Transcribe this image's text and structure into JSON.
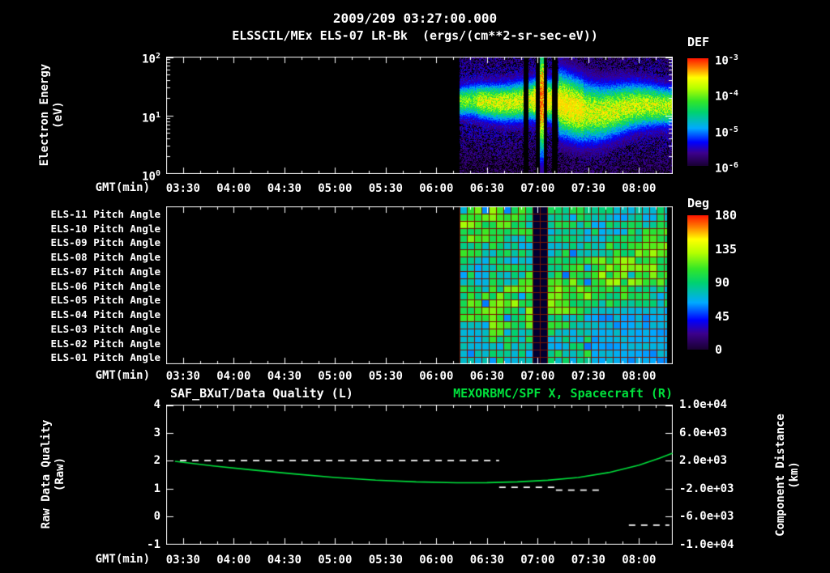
{
  "header": {
    "timestamp": "2009/209 03:27:00.000",
    "subtitle": "ELSSCIL/MEx ELS-07 LR-Bk  (ergs/(cm**2-sr-sec-eV))"
  },
  "colors": {
    "background": "#000000",
    "text": "#ffffff",
    "accent_green": "#00e03c",
    "grid_red": "#781400",
    "colormap_stops": [
      [
        0.0,
        "#190032"
      ],
      [
        0.12,
        "#3c008c"
      ],
      [
        0.22,
        "#0000ff"
      ],
      [
        0.35,
        "#00aaff"
      ],
      [
        0.5,
        "#00d26e"
      ],
      [
        0.6,
        "#32e628"
      ],
      [
        0.72,
        "#b4ff00"
      ],
      [
        0.82,
        "#ffff00"
      ],
      [
        0.91,
        "#ff8200"
      ],
      [
        1.0,
        "#ff1400"
      ]
    ]
  },
  "xaxis": {
    "label": "GMT(min)",
    "tick_labels": [
      "03:30",
      "04:00",
      "04:30",
      "05:00",
      "05:30",
      "06:00",
      "06:30",
      "07:00",
      "07:30",
      "08:00"
    ],
    "tick_hours": [
      3.5,
      4,
      4.5,
      5,
      5.5,
      6,
      6.5,
      7,
      7.5,
      8
    ]
  },
  "spectrogram_panel": {
    "ylabel": [
      "Electron Energy",
      "(eV)"
    ],
    "ytick_exponents": [
      2,
      1,
      0
    ],
    "colorbar": {
      "title": "DEF",
      "tick_exponents": [
        -3,
        -4,
        -5,
        -6
      ]
    }
  },
  "pitch_panel": {
    "row_labels": [
      "ELS-11 Pitch Angle",
      "ELS-10 Pitch Angle",
      "ELS-09 Pitch Angle",
      "ELS-08 Pitch Angle",
      "ELS-07 Pitch Angle",
      "ELS-06 Pitch Angle",
      "ELS-05 Pitch Angle",
      "ELS-04 Pitch Angle",
      "ELS-03 Pitch Angle",
      "ELS-02 Pitch Angle",
      "ELS-01 Pitch Angle"
    ],
    "colorbar": {
      "title": "Deg",
      "ticks": [
        180,
        135,
        90,
        45,
        0
      ]
    }
  },
  "timeseries_panel": {
    "title_left": "SAF_BXuT/Data Quality (L)",
    "title_right": "MEXORBMC/SPF X, Spacecraft (R)",
    "ylabel_left": [
      "Raw Data Quality",
      "(Raw)"
    ],
    "ylabel_right": [
      "Component Distance",
      "(km)"
    ],
    "left_ticks": [
      "4",
      "3",
      "2",
      "1",
      "0",
      "-1"
    ],
    "right_ticks": [
      "1.0e+04",
      "6.0e+03",
      "2.0e+03",
      "-2.0e+03",
      "-6.0e+03",
      "-1.0e+04"
    ]
  },
  "chart_data": [
    {
      "type": "heatmap",
      "name": "electron-energy-spectrogram",
      "title": "ELSSCIL/MEx ELS-07 LR-Bk",
      "units": "ergs/(cm**2-sr-sec-eV)",
      "x_axis": {
        "label": "GMT(min)",
        "range_hours": [
          3.3333,
          8.3333
        ],
        "tick_hours": [
          3.5,
          4,
          4.5,
          5,
          5.5,
          6,
          6.5,
          7,
          7.5,
          8
        ],
        "tick_labels": [
          "03:30",
          "04:00",
          "04:30",
          "05:00",
          "05:30",
          "06:00",
          "06:30",
          "07:00",
          "07:30",
          "08:00"
        ]
      },
      "y_axis": {
        "label": "Electron Energy (eV)",
        "scale": "log",
        "range_ev": [
          1,
          100
        ]
      },
      "colorbar": {
        "label": "DEF",
        "scale": "log",
        "tick_exponents": [
          -3,
          -4,
          -5,
          -6
        ]
      },
      "data_start_hour": 6.233,
      "data_end_hour": 8.333,
      "band_center_log10_ev": 1.18,
      "band_sigma_log10": 0.18,
      "gaps_hours": [
        [
          6.86,
          6.905
        ],
        [
          6.975,
          7.015
        ],
        [
          7.055,
          7.09
        ],
        [
          7.135,
          7.195
        ]
      ],
      "bright_columns_hours": [
        [
          7.015,
          7.055
        ]
      ],
      "bright_interval_hours": [
        6.95,
        7.45
      ]
    },
    {
      "type": "heatmap",
      "name": "pitch-angle-panels",
      "row_labels": [
        "ELS-11 Pitch Angle",
        "ELS-10 Pitch Angle",
        "ELS-09 Pitch Angle",
        "ELS-08 Pitch Angle",
        "ELS-07 Pitch Angle",
        "ELS-06 Pitch Angle",
        "ELS-05 Pitch Angle",
        "ELS-04 Pitch Angle",
        "ELS-03 Pitch Angle",
        "ELS-02 Pitch Angle",
        "ELS-01 Pitch Angle"
      ],
      "colorbar": {
        "label": "Deg",
        "range_deg": [
          0,
          180
        ],
        "ticks_deg": [
          180,
          135,
          90,
          45,
          0
        ]
      },
      "data_start_hour": 6.233,
      "data_end_hour": 8.28,
      "typical_pitch_deg": 95,
      "pitch_spread_deg": 25,
      "gaps_hours": [
        [
          6.86,
          6.905
        ],
        [
          6.975,
          7.015
        ],
        [
          7.055,
          7.09
        ],
        [
          7.135,
          7.195
        ]
      ]
    },
    {
      "type": "line",
      "name": "data-quality-and-spacecraft-distance",
      "title_left": "SAF_BXuT/Data Quality (L)",
      "title_right": "MEXORBMC/SPF X, Spacecraft (R)",
      "left_axis": {
        "label": "Raw Data Quality (Raw)",
        "range": [
          -1,
          4
        ],
        "ticks": [
          4,
          3,
          2,
          1,
          0,
          -1
        ]
      },
      "right_axis": {
        "label": "Component Distance (km)",
        "range": [
          -10000,
          10000
        ],
        "ticks": [
          10000,
          6000,
          2000,
          -2000,
          -6000,
          -10000
        ]
      },
      "series": [
        {
          "name": "SAF_BXuT/Data Quality (L)",
          "axis": "left",
          "style": "dashed",
          "color": "#ffffff",
          "segments": [
            {
              "x_hours": [
                3.47,
                6.62
              ],
              "y": 2.0
            },
            {
              "x_hours": [
                6.62,
                7.18
              ],
              "y": 1.05
            },
            {
              "x_hours": [
                7.18,
                7.62
              ],
              "y": 0.95
            },
            {
              "x_hours": [
                7.9,
                8.3
              ],
              "y": -0.3
            }
          ]
        },
        {
          "name": "MEXORBMC/SPF X, Spacecraft (R)",
          "axis": "right",
          "style": "solid",
          "color": "#00e03c",
          "points_hours_km": [
            [
              3.42,
              1900
            ],
            [
              3.8,
              1250
            ],
            [
              4.2,
              650
            ],
            [
              4.6,
              100
            ],
            [
              5.0,
              -400
            ],
            [
              5.4,
              -780
            ],
            [
              5.8,
              -1030
            ],
            [
              6.2,
              -1150
            ],
            [
              6.5,
              -1140
            ],
            [
              6.8,
              -1030
            ],
            [
              7.1,
              -800
            ],
            [
              7.4,
              -400
            ],
            [
              7.7,
              300
            ],
            [
              8.0,
              1350
            ],
            [
              8.2,
              2350
            ],
            [
              8.33,
              3050
            ]
          ]
        }
      ]
    }
  ]
}
